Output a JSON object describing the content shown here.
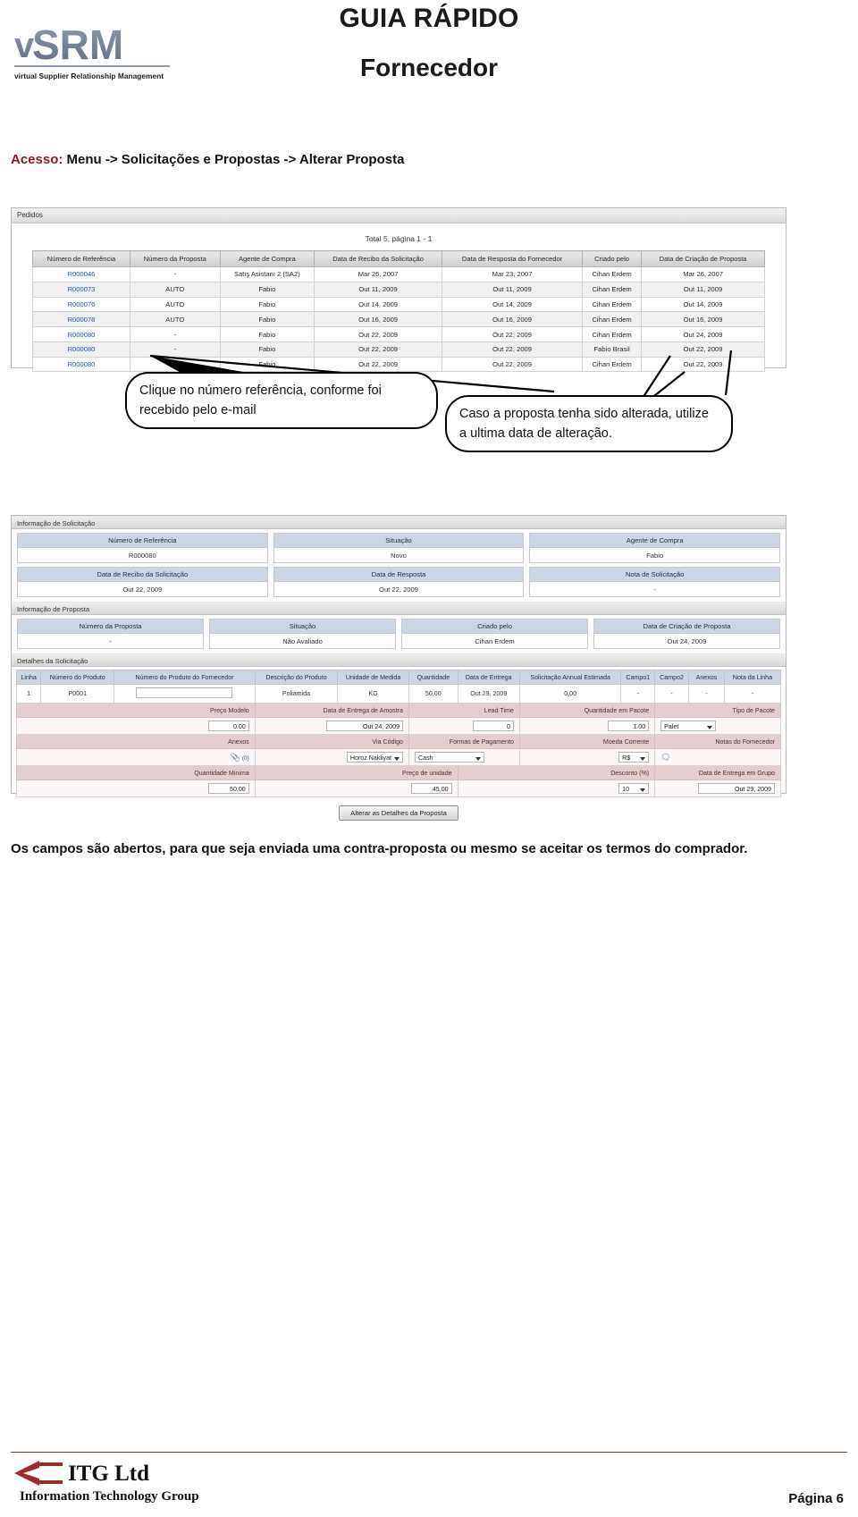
{
  "header": {
    "title": "GUIA RÁPIDO",
    "subtitle": "Fornecedor",
    "logo_text": "vSRM",
    "logo_tagline": "virtual Supplier Relationship Management"
  },
  "access": {
    "label": "Acesso:",
    "path": "Menu -> Solicitações e Propostas -> Alterar Proposta"
  },
  "pedidos_panel": {
    "panel_title": "Pedidos",
    "total_line": "Total 5, página 1 - 1",
    "columns": [
      "Número de Referência",
      "Número da Proposta",
      "Agente de Compra",
      "Data de Recibo da Solicitação",
      "Data de Resposta do Fornecedor",
      "Criado pelo",
      "Data de Criação de Proposta"
    ],
    "rows": [
      [
        "R000046",
        "-",
        "Satış Asistanı 2 (SA2)",
        "Mar 26, 2007",
        "Mar 23, 2007",
        "Cihan Erdem",
        "Mar 26, 2007"
      ],
      [
        "R000073",
        "AUTO",
        "Fabio",
        "Out 11, 2009",
        "Out 11, 2009",
        "Cihan Erdem",
        "Out 11, 2009"
      ],
      [
        "R000076",
        "AUTO",
        "Fabio",
        "Out 14, 2009",
        "Out 14, 2009",
        "Cihan Erdem",
        "Out 14, 2009"
      ],
      [
        "R000078",
        "AUTO",
        "Fabio",
        "Out 16, 2009",
        "Out 16, 2009",
        "Cihan Erdem",
        "Out 16, 2009"
      ],
      [
        "R000080",
        "-",
        "Fabio",
        "Out 22, 2009",
        "Out 22, 2009",
        "Cihan Erdem",
        "Out 24, 2009"
      ],
      [
        "R000080",
        "-",
        "Fabio",
        "Out 22, 2009",
        "Out 22, 2009",
        "Fabio Brasil",
        "Out 22, 2009"
      ],
      [
        "R000080",
        "-",
        "Fabio",
        "Out 22, 2009",
        "Out 22, 2009",
        "Cihan Erdem",
        "Out 22, 2009"
      ]
    ]
  },
  "callouts": {
    "one": "Clique no número referência, conforme foi recebido pelo e-mail",
    "two": "Caso a proposta tenha sido alterada, utilize a ultima data de alteração."
  },
  "form_panel": {
    "section_solicitacao": "Informação de Solicitação",
    "section_proposta": "Informação de Proposta",
    "section_detalhes": "Detalhes da Solicitação",
    "solicitacao_row1": [
      {
        "label": "Número de Referência",
        "value": "R000080"
      },
      {
        "label": "Situação",
        "value": "Novo"
      },
      {
        "label": "Agente de Compra",
        "value": "Fabio"
      }
    ],
    "solicitacao_row2": [
      {
        "label": "Data de Recibo da Solicitação",
        "value": "Out 22, 2009"
      },
      {
        "label": "Data de Resposta",
        "value": "Out 22, 2009"
      },
      {
        "label": "Nota de Solicitação",
        "value": "-"
      }
    ],
    "proposta_row": [
      {
        "label": "Número da Proposta",
        "value": "-"
      },
      {
        "label": "Situação",
        "value": "Não Avaliado"
      },
      {
        "label": "Criado pelo",
        "value": "Cihan Erdem"
      },
      {
        "label": "Data de Criação de Proposta",
        "value": "Out 24, 2009"
      }
    ],
    "detalhes_columns": [
      "Linha",
      "Número do Produto",
      "Número do Produto do Fornecedor",
      "Descrição do Produto",
      "Unidade de Medida",
      "Quantidade",
      "Data de Entrega",
      "Solicitação Annual Estimada",
      "Campo1",
      "Campo2",
      "Anexos",
      "Nota da Linha"
    ],
    "detalhes_row": {
      "linha": "1",
      "numero_produto": "P0001",
      "numero_produto_fornecedor": "",
      "descricao": "Poliamida",
      "unidade": "KG",
      "quantidade": "50,00",
      "data_entrega": "Out 29, 2009",
      "solicitacao_anual": "0,00",
      "campo1": "-",
      "campo2": "-",
      "anexos": "-",
      "nota_linha": "-"
    },
    "band1_labels": [
      "Preço Modelo",
      "Data de Entrega de Amostra",
      "Lead Time",
      "Quantidade em Pacote",
      "Tipo de Pacote"
    ],
    "band1_values": {
      "preco_modelo": "0.00",
      "data_entrega_amostra": "Out 24, 2009",
      "lead_time": "0",
      "quantidade_pacote": "1.00",
      "tipo_pacote": "Palet"
    },
    "band2_labels": [
      "Anexos",
      "Via Código",
      "Formas de Pagamento",
      "Moeda Corrente",
      "Notas do Fornecedor"
    ],
    "band2_values": {
      "anexos_count": "(0)",
      "via_codigo": "Horoz Nakliyat",
      "formas_pagamento": "Cash",
      "moeda_corrente": "R$",
      "notas_fornecedor_icon": "note-icon"
    },
    "band3_labels": [
      "Quantidade Minima",
      "Preço de unidade",
      "Desconto (%)",
      "Data de Entrega em Grupo"
    ],
    "band3_values": {
      "quantidade_minima": "50,00",
      "preco_unidade": "45,00",
      "desconto": "10",
      "data_entrega_grupo": "Out 29, 2009"
    },
    "submit_button": "Alterar as Detalhes da Proposta"
  },
  "paragraph": "Os campos são abertos, para que seja enviada uma contra-proposta ou mesmo se aceitar os termos do comprador.",
  "footer": {
    "company_name": "ITG Ltd",
    "company_sub": "Information Technology Group",
    "page_label": "Página 6",
    "rule_color": "#9b2c2c"
  }
}
